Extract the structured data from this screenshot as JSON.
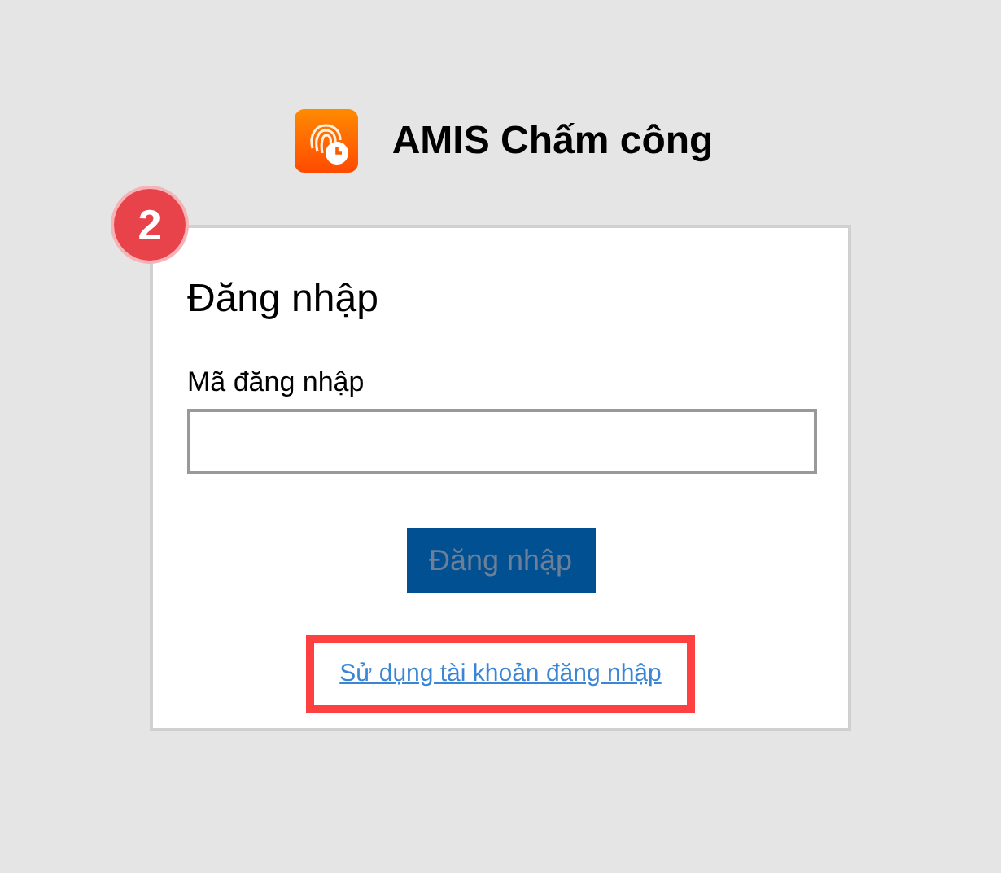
{
  "app": {
    "title": "AMIS Chấm công"
  },
  "step_badge": "2",
  "login_card": {
    "heading": "Đăng nhập",
    "field": {
      "label": "Mã đăng nhập"
    },
    "submit_button": {
      "label": "Đăng nhập",
      "disabled": true
    },
    "link": {
      "label": "Sử dụng tài khoản đăng nhập",
      "highlighted": true
    }
  }
}
